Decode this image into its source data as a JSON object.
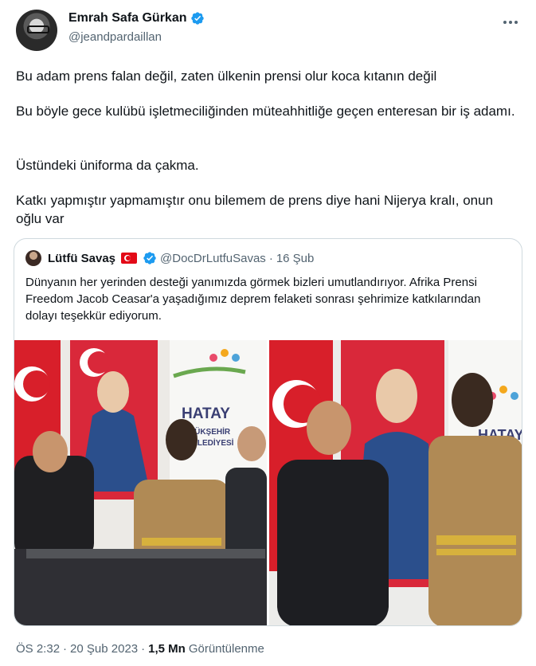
{
  "author": {
    "display_name": "Emrah Safa Gürkan",
    "handle": "@jeandpardaillan",
    "verified_icon": "verified-badge-icon"
  },
  "tweet": {
    "paragraphs": [
      "Bu adam prens falan değil, zaten ülkenin prensi olur koca kıtanın değil",
      "Bu böyle gece kulübü işletmeciliğinden müteahhitliğe geçen enteresan bir iş adamı.",
      "Üstündeki üniforma da çakma.",
      "Katkı yapmıştır yapmamıştır onu bilemem de prens diye hani Nijerya kralı, onun oğlu var"
    ]
  },
  "quoted": {
    "display_name": "Lütfü Savaş",
    "handle": "@DocDrLutfuSavas",
    "separator": "·",
    "date": "16 Şub",
    "text": "Dünyanın her yerinden desteği yanımızda görmek bizleri umutlandırıyor. Afrika Prensi Freedom Jacob Ceasar'a yaşadığımız deprem felaketi sonrası şehrimize katkılarından dolayı teşekkür ediyorum.",
    "photo_left_sign": [
      "HATAY",
      "BÜYÜKŞEHİR",
      "BELEDİYESİ"
    ],
    "photo_right_sign": "HATAY"
  },
  "footer": {
    "time": "ÖS 2:32",
    "sep1": "·",
    "date": "20 Şub 2023",
    "sep2": "·",
    "views_count": "1,5 Mn",
    "views_label": "Görüntülenme"
  },
  "colors": {
    "verified": "#1d9bf0",
    "secondary_text": "#536471",
    "flag_red": "#e30a17"
  }
}
